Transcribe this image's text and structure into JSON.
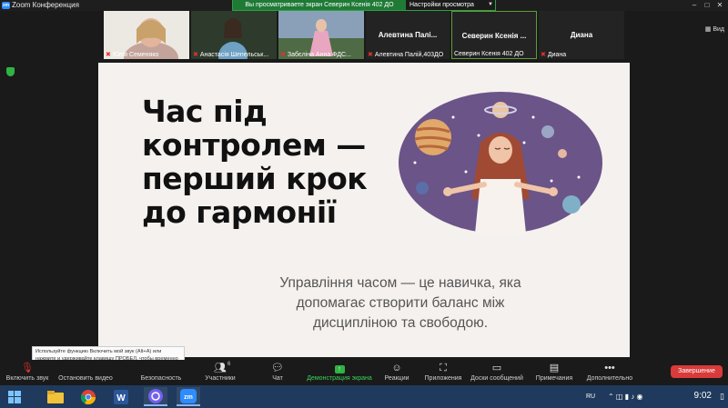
{
  "window": {
    "title": "Zoom Конференция",
    "app_icon": "zm"
  },
  "share_banner": {
    "message": "Вы просматриваете экран Северин Ксенія 402 ДО",
    "options_label": "Настройки просмотра"
  },
  "participants": [
    {
      "name": "Юлія Семеняко",
      "muted": true
    },
    {
      "name": "Анастасія Шепельськ...",
      "muted": true
    },
    {
      "name": "Забєліна Анна ФДС...",
      "muted": true
    },
    {
      "display_name": "Алевтина Палі...",
      "name": "Алевтина Палій,403ДО",
      "muted": true
    },
    {
      "display_name": "Северин Ксенія ...",
      "name": "Северин Ксенія 402 ДО",
      "muted": false,
      "active": true
    },
    {
      "display_name": "Диана",
      "name": "Диана",
      "muted": true
    }
  ],
  "view_label": "Вид",
  "slide": {
    "title": "Час під контролем — перший крок до гармонії",
    "subtitle": "Управління часом — це навичка, яка допомагає створити баланс між дисципліною та свободою."
  },
  "tooltip": "Используйте функцию Включить мой звук (Alt+A) или нажмите и удерживайте клавишу ПРОБЕЛ, чтобы временно включить звук.",
  "toolbar": {
    "unmute": "Включить звук",
    "stop_video": "Остановить видео",
    "security": "Безопасность",
    "participants": "Участники",
    "participants_count": "6",
    "chat": "Чат",
    "share": "Демонстрация экрана",
    "reactions": "Реакции",
    "apps": "Приложения",
    "whiteboards": "Доски сообщений",
    "notes": "Примечания",
    "more": "Дополнительно",
    "end": "Завершение"
  },
  "taskbar": {
    "lang": "RU",
    "time": "9:02"
  },
  "colors": {
    "accent_green": "#2fb344",
    "end_red": "#d93a3a",
    "taskbar": "#1f3a5c",
    "slide_bg": "#f5f1ee",
    "illustration_purple": "#6a5488"
  }
}
